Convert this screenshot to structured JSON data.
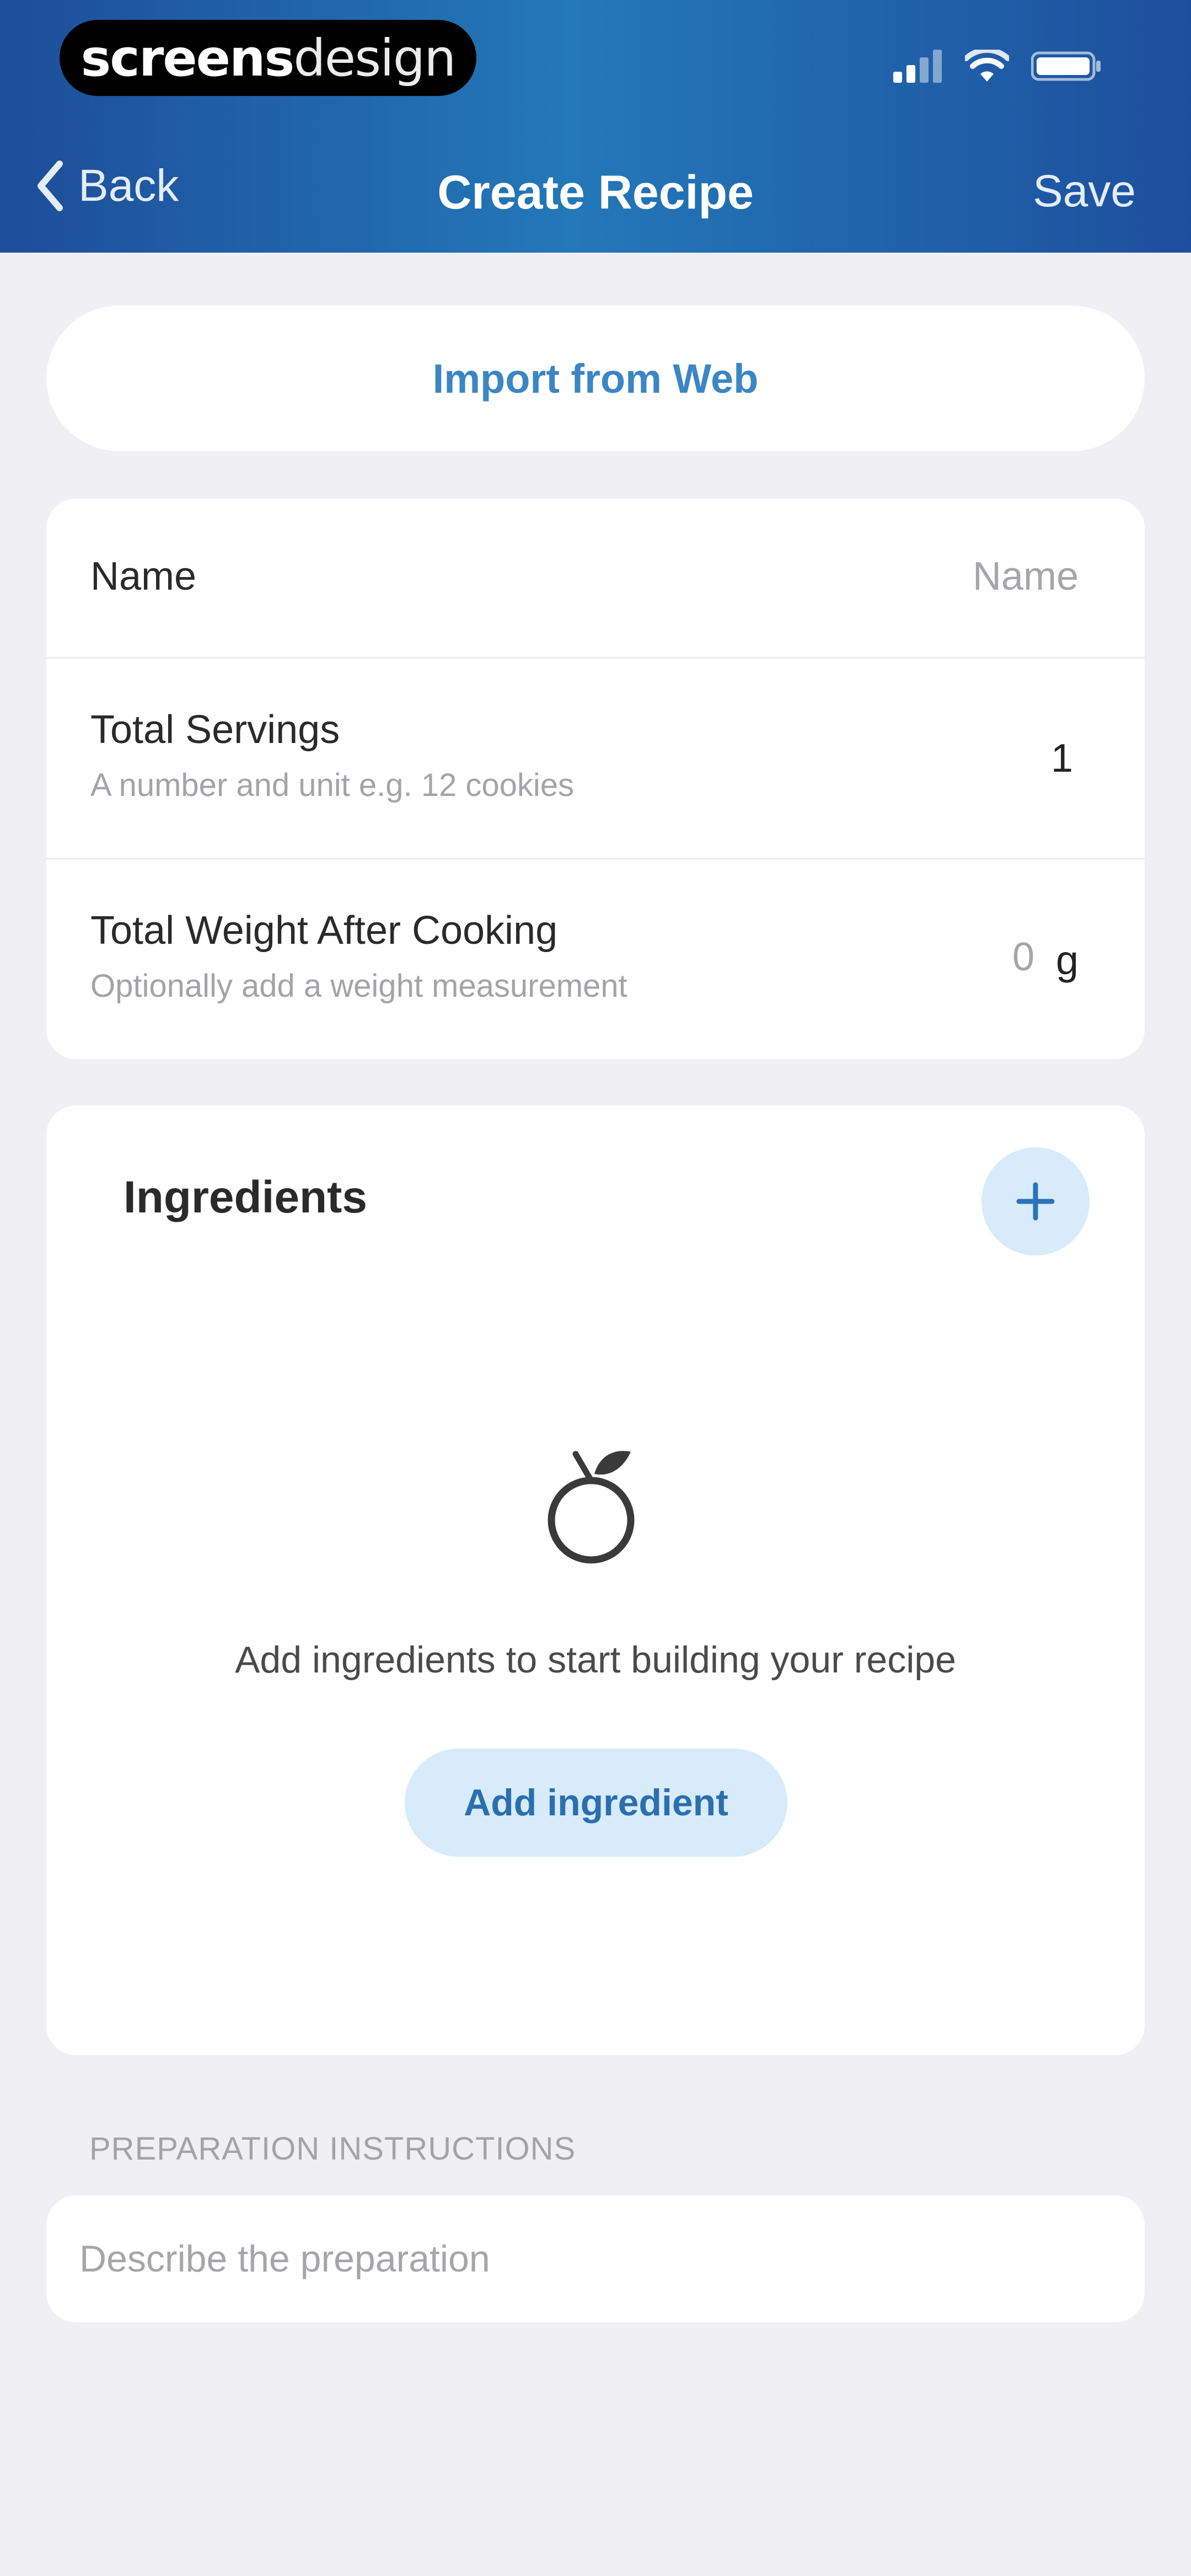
{
  "status_bar": {
    "brand_bold": "screens",
    "brand_light": "design"
  },
  "nav": {
    "back_label": "Back",
    "title": "Create Recipe",
    "save_label": "Save"
  },
  "import_button": {
    "label": "Import from Web"
  },
  "form": {
    "name": {
      "label": "Name",
      "placeholder": "Name"
    },
    "servings": {
      "label": "Total Servings",
      "hint": "A number and unit e.g. 12 cookies",
      "value": "1"
    },
    "weight": {
      "label": "Total Weight After Cooking",
      "hint": "Optionally add a weight measurement",
      "placeholder": "0",
      "unit": "g"
    }
  },
  "ingredients": {
    "title": "Ingredients",
    "empty_message": "Add ingredients to start building your recipe",
    "add_button_label": "Add ingredient"
  },
  "preparation": {
    "heading": "PREPARATION INSTRUCTIONS",
    "placeholder": "Describe the preparation"
  },
  "icons": {
    "back": "chevron-left-icon",
    "add": "plus-icon",
    "empty_state": "apple-icon",
    "signal": "cellular-signal-icon",
    "wifi": "wifi-icon",
    "battery": "battery-icon"
  },
  "colors": {
    "header_start": "#1d4e99",
    "header_mid": "#2378b8",
    "accent": "#3b86c5",
    "accent_light": "#d7ebfa",
    "background": "#efeff4"
  }
}
